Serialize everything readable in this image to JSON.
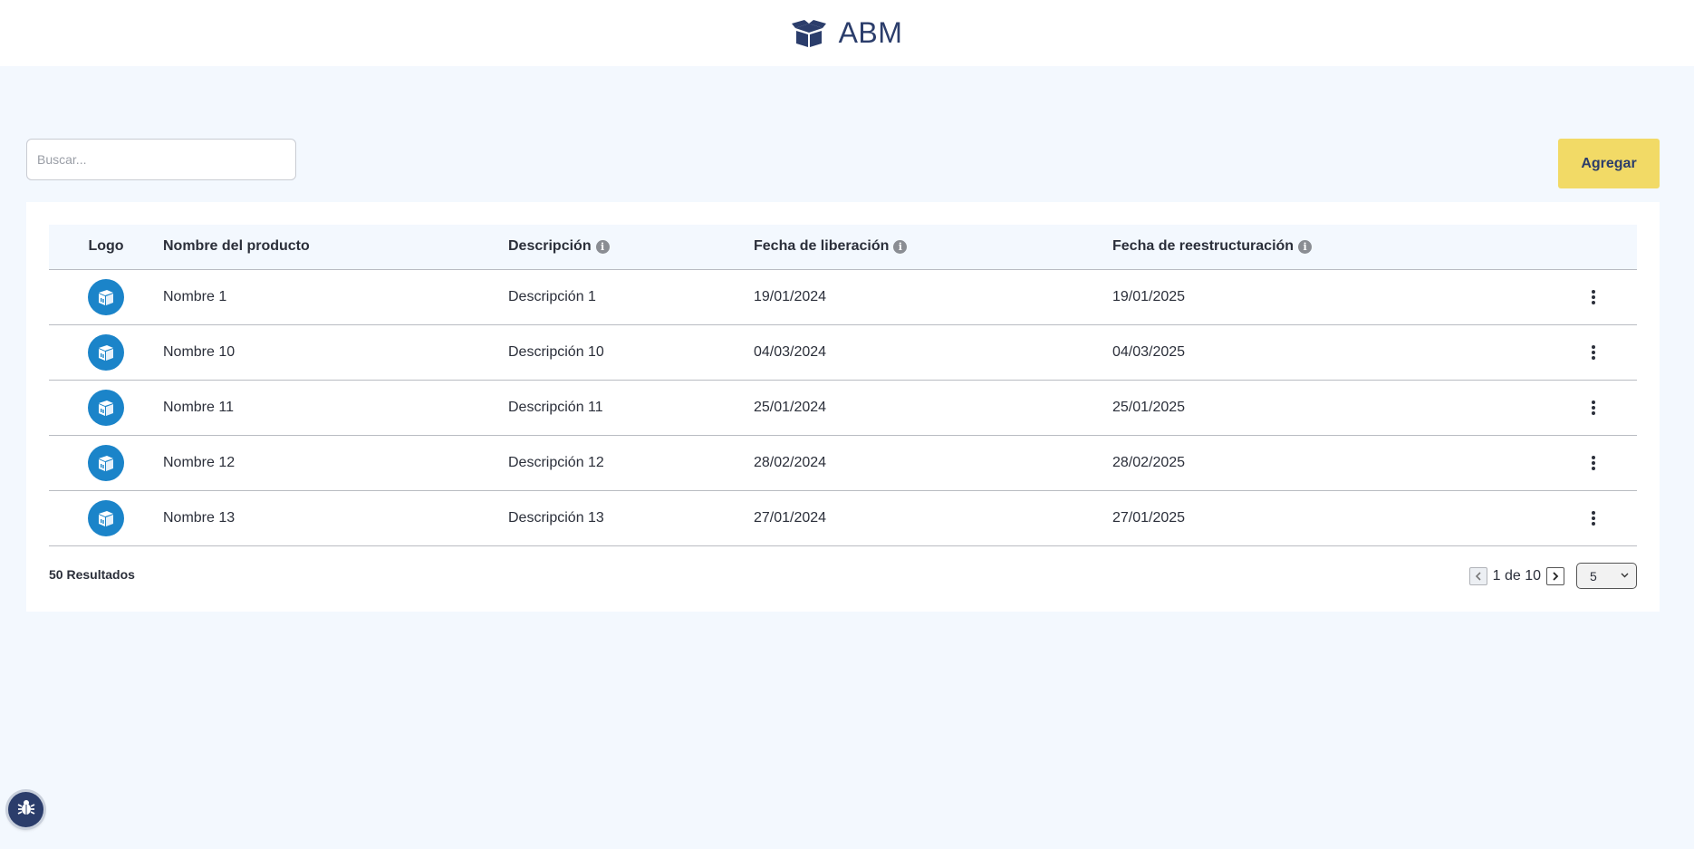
{
  "header": {
    "title": "ABM",
    "logo_icon": "open-box-icon"
  },
  "search": {
    "placeholder": "Buscar...",
    "value": ""
  },
  "toolbar": {
    "add_label": "Agregar"
  },
  "table": {
    "columns": {
      "logo": "Logo",
      "name": "Nombre del producto",
      "description": "Descripción",
      "release_date": "Fecha de liberación",
      "restructure_date": "Fecha de reestructuración"
    },
    "rows": [
      {
        "name": "Nombre 1",
        "description": "Descripción 1",
        "release_date": "19/01/2024",
        "restructure_date": "19/01/2025"
      },
      {
        "name": "Nombre 10",
        "description": "Descripción 10",
        "release_date": "04/03/2024",
        "restructure_date": "04/03/2025"
      },
      {
        "name": "Nombre 11",
        "description": "Descripción 11",
        "release_date": "25/01/2024",
        "restructure_date": "25/01/2025"
      },
      {
        "name": "Nombre 12",
        "description": "Descripción 12",
        "release_date": "28/02/2024",
        "restructure_date": "28/02/2025"
      },
      {
        "name": "Nombre 13",
        "description": "Descripción 13",
        "release_date": "27/01/2024",
        "restructure_date": "27/01/2025"
      }
    ]
  },
  "footer": {
    "results": "50 Resultados",
    "page_label": "1 de 10",
    "page_size": "5"
  },
  "colors": {
    "background": "#f3f8fe",
    "brand": "#2b3d6b",
    "accent_button": "#f2da66",
    "row_logo": "#1b84c9"
  }
}
